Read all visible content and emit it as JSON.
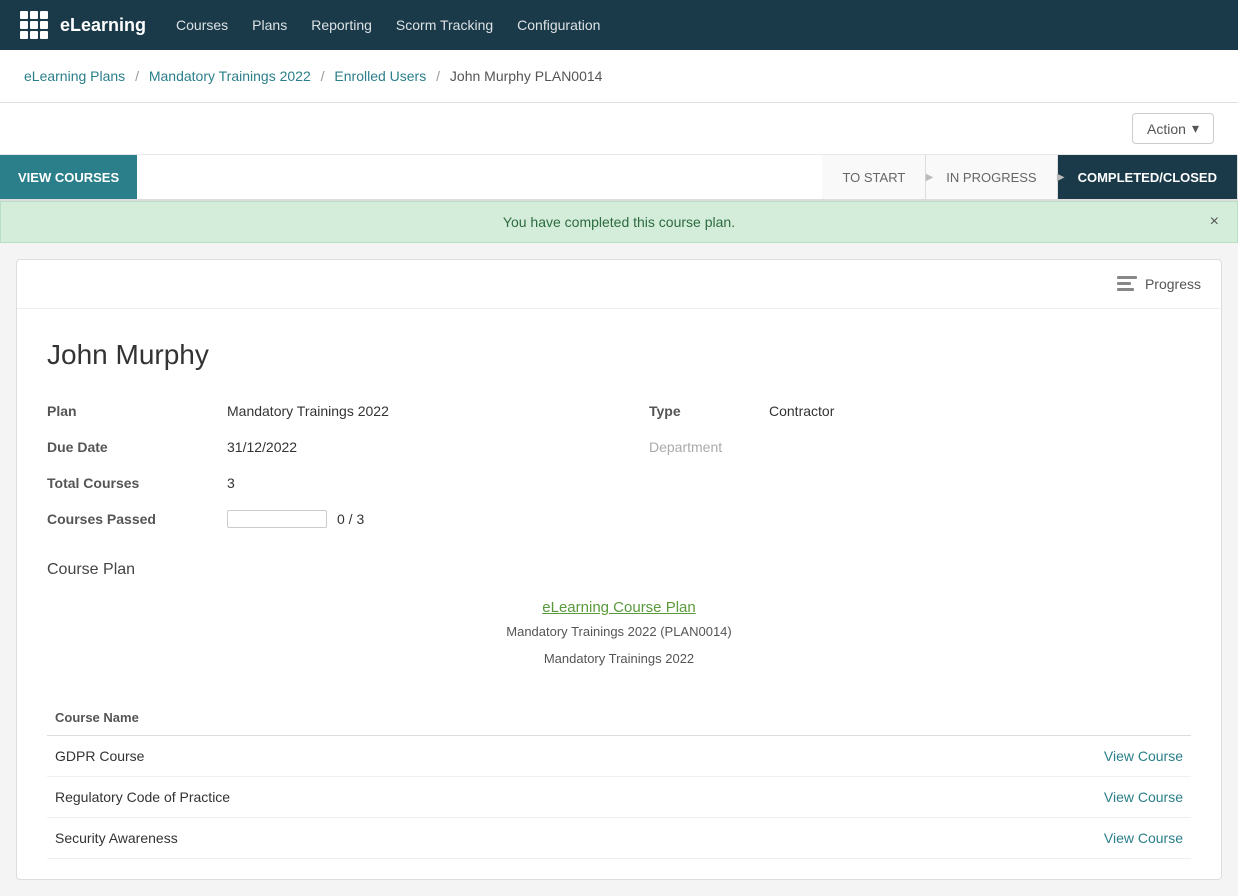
{
  "nav": {
    "brand": "eLearning",
    "links": [
      "Courses",
      "Plans",
      "Reporting",
      "Scorm Tracking",
      "Configuration"
    ]
  },
  "breadcrumb": {
    "items": [
      {
        "label": "eLearning Plans",
        "href": "#"
      },
      {
        "label": "Mandatory Trainings 2022",
        "href": "#"
      },
      {
        "label": "Enrolled Users",
        "href": "#"
      },
      {
        "label": "John Murphy PLAN0014",
        "href": null
      }
    ]
  },
  "action": {
    "label": "Action"
  },
  "tabs": {
    "view_courses_label": "VIEW COURSES",
    "to_start_label": "TO START",
    "in_progress_label": "IN PROGRESS",
    "completed_label": "COMPLETED/CLOSED"
  },
  "alert": {
    "message": "You have completed this course plan.",
    "close_label": "×"
  },
  "card": {
    "progress_label": "Progress",
    "user_name": "John Murphy",
    "plan_label": "Plan",
    "plan_value": "Mandatory Trainings 2022",
    "due_date_label": "Due Date",
    "due_date_value": "31/12/2022",
    "total_courses_label": "Total Courses",
    "total_courses_value": "3",
    "courses_passed_label": "Courses Passed",
    "courses_passed_fraction": "0 / 3",
    "courses_passed_percent": 0,
    "type_label": "Type",
    "type_value": "Contractor",
    "department_label": "Department",
    "department_value": "",
    "course_plan_section": "Course Plan",
    "elearning_plan_link": "eLearning Course Plan",
    "plan_subtitle_1": "Mandatory Trainings 2022 (PLAN0014)",
    "plan_subtitle_2": "Mandatory Trainings 2022",
    "course_name_header": "Course Name",
    "courses": [
      {
        "name": "GDPR Course",
        "action": "View Course"
      },
      {
        "name": "Regulatory Code of Practice",
        "action": "View Course"
      },
      {
        "name": "Security Awareness",
        "action": "View Course"
      }
    ]
  }
}
